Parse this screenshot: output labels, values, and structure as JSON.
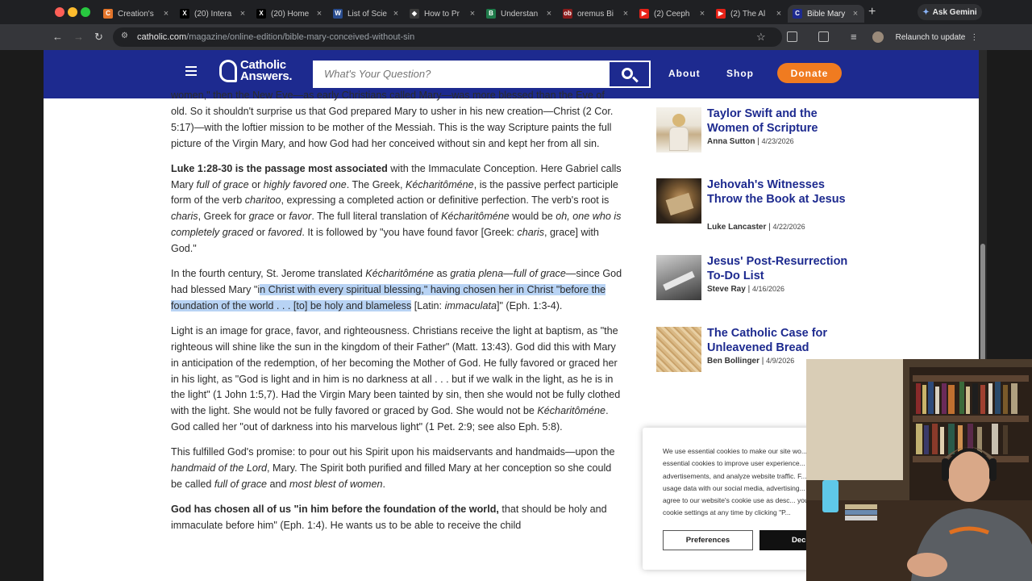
{
  "browser": {
    "tabs": [
      {
        "label": "Creation's",
        "favicon_color": "#e3752b",
        "favicon_glyph": "C",
        "active": false
      },
      {
        "label": "(20) Intera",
        "favicon_color": "#000000",
        "favicon_glyph": "X",
        "active": false
      },
      {
        "label": "(20) Home",
        "favicon_color": "#000000",
        "favicon_glyph": "X",
        "active": false
      },
      {
        "label": "List of Scie",
        "favicon_color": "#2a4d8f",
        "favicon_glyph": "W",
        "active": false
      },
      {
        "label": "How to Pr",
        "favicon_color": "#3a3a3a",
        "favicon_glyph": "◆",
        "active": false
      },
      {
        "label": "Understan",
        "favicon_color": "#1f7a4a",
        "favicon_glyph": "B",
        "active": false
      },
      {
        "label": "oremus Bi",
        "favicon_color": "#8a1c1c",
        "favicon_glyph": "ob",
        "active": false
      },
      {
        "label": "(2) Ceeph",
        "favicon_color": "#e62117",
        "favicon_glyph": "▶",
        "active": false
      },
      {
        "label": "(2) The Al",
        "favicon_color": "#e62117",
        "favicon_glyph": "▶",
        "active": false
      },
      {
        "label": "Bible Mary",
        "favicon_color": "#1d2a8f",
        "favicon_glyph": "C",
        "active": true
      }
    ],
    "new_tab_label": "+",
    "gemini_label": "Ask Gemini",
    "url_host": "catholic.com",
    "url_path": "/magazine/online-edition/bible-mary-conceived-without-sin",
    "relaunch_label": "Relaunch to update"
  },
  "header": {
    "logo_line1": "Catholic",
    "logo_line2": "Answers.",
    "search_placeholder": "What's Your Question?",
    "nav": [
      "About",
      "Shop"
    ],
    "donate_label": "Donate",
    "brand_color": "#1d2a8f",
    "donate_color": "#f07b20"
  },
  "article": {
    "p1": "women,\" then the New Eve—as early Christians called Mary—was more blessed than the Eve of old. So it shouldn't surprise us that God prepared Mary to usher in his new creation—Christ (2 Cor. 5:17)—with the loftier mission to be mother of the Messiah. This is the way Scripture paints the full picture of the Virgin Mary, and how God had her conceived without sin and kept her from all sin.",
    "p2": {
      "s1": "Luke 1:28-30 is the passage most associated",
      "s2": " with the Immaculate Conception. Here Gabriel calls Mary ",
      "s3": "full of grace",
      "s4": " or ",
      "s5": "highly favored one",
      "s6": ". The Greek, ",
      "s7": "Kécharitôméne",
      "s8": ", is the passive perfect participle form of the verb ",
      "s9": "charitoo",
      "s10": ", expressing a completed action or definitive perfection. The verb's root is ",
      "s11": "charis",
      "s12": ", Greek for ",
      "s13": "grace",
      "s14": " or ",
      "s15": "favor",
      "s16": ". The full literal translation of ",
      "s17": "Kécharitôméne",
      "s18": " would be ",
      "s19": "oh, one who is completely graced",
      "s20": " or ",
      "s21": "favored",
      "s22": ". It is followed by \"you have found favor [Greek: ",
      "s23": "charis",
      "s24": ", grace] with God.\""
    },
    "p3": {
      "s1": "In the fourth century, St. Jerome translated ",
      "s2": "Kécharitôméne",
      "s3": " as ",
      "s4": "gratia plena",
      "s5": "—",
      "s6": "full of grace",
      "s7": "—since God had blessed Mary \"i",
      "s8": "n Christ with every spiritual blessing,\" having chosen her in Christ \"before the foundation of the world . . . [to] be holy and blameless",
      "s9": " [Latin: ",
      "s10": "immaculata",
      "s11": "]\" (Eph. 1:3-4)."
    },
    "p4": {
      "s1": "Light is an image for grace, favor, and righteousness. Christians receive the light at baptism, as \"the righteous will shine like the sun in the kingdom of their Father\" (Matt. 13:43). God did this with Mary in anticipation of the redemption, of her becoming the Mother of God. He fully favored or graced her in his light, as \"God is light and in him is no darkness at all . . . but if we walk in the light, as he is in the light\" (1 John 1:5,7). Had the Virgin Mary been tainted by sin, then she would not be fully clothed with the light. She would not be fully favored or graced by God. She would not be ",
      "s2": "Kécharitôméne",
      "s3": ". God called her \"out of darkness into his marvelous light\" (1 Pet. 2:9; see also Eph. 5:8)."
    },
    "p5": {
      "s1": "This fulfilled God's promise: to pour out his Spirit upon his maidservants and handmaids—upon the ",
      "s2": "handmaid of the Lord",
      "s3": ", Mary. The Spirit both purified and filled Mary at her conception so she could be called ",
      "s4": "full of grace",
      "s5": " and ",
      "s6": "most blest of women",
      "s7": "."
    },
    "p6": {
      "s1": "God has chosen all of us \"in him before the foundation of the world,",
      "s2": " that should be holy and immaculate before him\" (Eph. 1:4). He wants us to be able to receive the child"
    }
  },
  "sidebar": {
    "related": [
      {
        "title": "Taylor Swift and the Women of Scripture",
        "author": "Anna Sutton",
        "date": "4/23/2026"
      },
      {
        "title": "Jehovah's Witnesses Throw the Book at Jesus",
        "author": "Luke Lancaster",
        "date": "4/22/2026"
      },
      {
        "title": "Jesus' Post-Resurrection To-Do List",
        "author": "Steve Ray",
        "date": "4/16/2026"
      },
      {
        "title": "The Catholic Case for Unleavened Bread",
        "author": "Ben Bollinger",
        "date": "4/9/2026"
      }
    ]
  },
  "cookie": {
    "text": "We use essential cookies to make our site wo... essential cookies to improve user experience... advertisements, and analyze website traffic. F... usage data with our social media, advertising... you agree to our website's cookie use as desc... your cookie settings at any time by clicking \"P...",
    "preferences_label": "Preferences",
    "decline_label": "Decl"
  }
}
